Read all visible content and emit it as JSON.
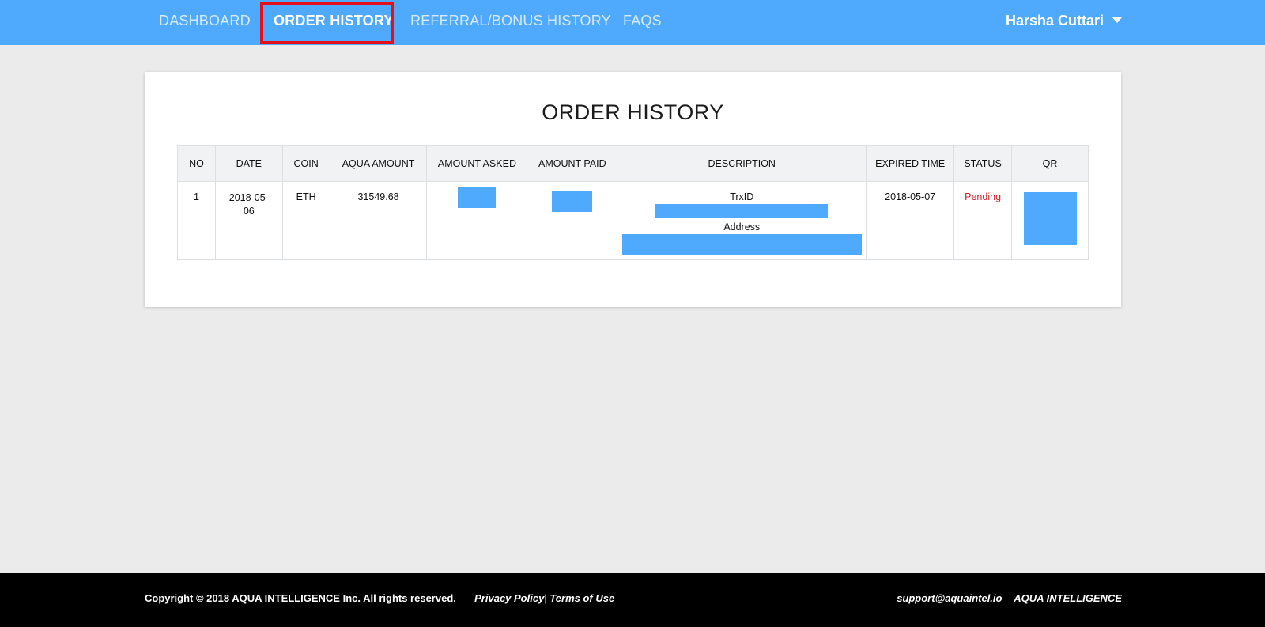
{
  "nav": {
    "items": [
      {
        "label": "DASHBOARD"
      },
      {
        "label": "ORDER HISTORY"
      },
      {
        "label": "REFERRAL/BONUS HISTORY"
      },
      {
        "label": "FAQS"
      }
    ],
    "active": "ORDER HISTORY",
    "user_name": "Harsha Cuttari",
    "user_menu_icon": "chevron-down-icon"
  },
  "page": {
    "title": "ORDER HISTORY"
  },
  "orders_table": {
    "columns": [
      "NO",
      "DATE",
      "COIN",
      "AQUA AMOUNT",
      "AMOUNT ASKED",
      "AMOUNT PAID",
      "DESCRIPTION",
      "EXPIRED TIME",
      "STATUS",
      "QR"
    ],
    "rows": [
      {
        "no": "1",
        "date_line1": "2018-05-",
        "date_line2": "06",
        "coin": "ETH",
        "aqua_amount": "31549.68",
        "description_trx_label": "TrxID",
        "description_address_label": "Address",
        "expired_time": "2018-05-07",
        "status": "Pending"
      }
    ]
  },
  "footer": {
    "copyright": "Copyright © 2018 AQUA INTELLIGENCE Inc. All rights reserved.",
    "privacy": "Privacy Policy",
    "separator": "|",
    "terms": "Terms of Use",
    "email": "support@aquaintel.io",
    "brand": "AQUA INTELLIGENCE"
  },
  "colors": {
    "nav_bg": "#4faafd",
    "active_outline": "#e3101b",
    "status_pending": "#d0212a",
    "redaction": "#4faafd"
  }
}
